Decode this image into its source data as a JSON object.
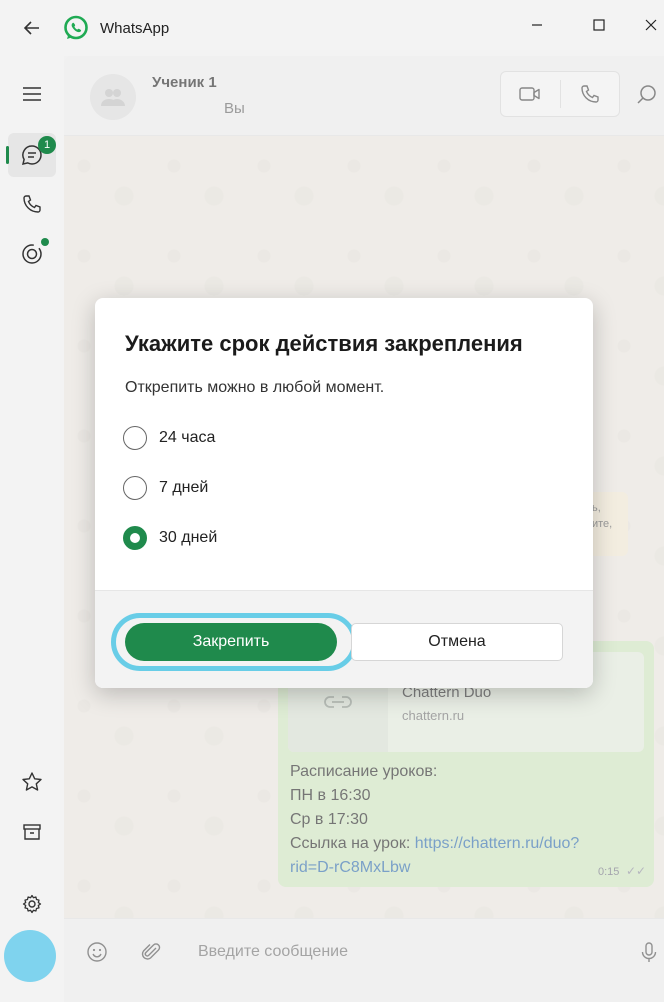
{
  "app": {
    "title": "WhatsApp"
  },
  "chat": {
    "contact_name": "Ученик 1",
    "contact_sub": "Вы"
  },
  "message": {
    "link_title": "Chattern Duo",
    "link_url": "chattern.ru",
    "lines": [
      "Расписание уроков:",
      "ПН в 16:30",
      "Ср в 17:30"
    ],
    "link_prefix": "Ссылка на урок: ",
    "link_href_line1": "https://chattern.ru/duo?",
    "link_href_line2": "rid=D-rC8MxLbw",
    "time": "0:15",
    "ticks": "✓✓"
  },
  "side_bubble": {
    "line1": "ь,",
    "line2": "ите,"
  },
  "rail": {
    "chats_badge": "1"
  },
  "composer": {
    "placeholder": "Введите сообщение"
  },
  "dialog": {
    "title": "Укажите срок действия закрепления",
    "description": "Открепить можно в любой момент.",
    "options": [
      {
        "label": "24 часа",
        "checked": false
      },
      {
        "label": "7 дней",
        "checked": false
      },
      {
        "label": "30 дней",
        "checked": true
      }
    ],
    "confirm_label": "Закрепить",
    "cancel_label": "Отмена"
  },
  "colors": {
    "accent": "#1f8a4c",
    "highlight": "#68cde7",
    "bubble_out": "#cfe9bd"
  }
}
